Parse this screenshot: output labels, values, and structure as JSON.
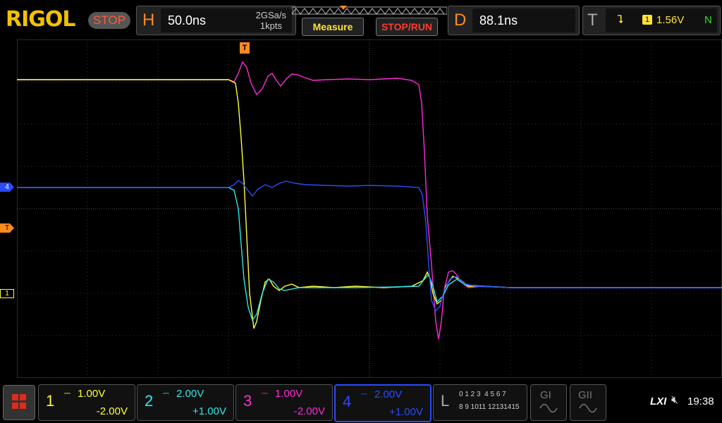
{
  "brand": "RIGOL",
  "run_state": "STOP",
  "horizontal": {
    "letter": "H",
    "timebase": "50.0ns",
    "sample_rate": "2GSa/s",
    "mem_depth": "1kpts"
  },
  "buttons": {
    "measure": "Measure",
    "stop_run": "STOP/RUN"
  },
  "delay": {
    "letter": "D",
    "value": "88.1ns"
  },
  "trigger": {
    "letter": "T",
    "source": "1",
    "level": "1.56V",
    "mode": "N"
  },
  "channels": [
    {
      "num": "1",
      "scale": "1.00V",
      "offset": "-2.00V",
      "color": "#ffff3a"
    },
    {
      "num": "2",
      "scale": "2.00V",
      "offset": "+1.00V",
      "color": "#2ee8e8"
    },
    {
      "num": "3",
      "scale": "1.00V",
      "offset": "-2.00V",
      "color": "#ff2bd6"
    },
    {
      "num": "4",
      "scale": "2.00V",
      "offset": "+1.00V",
      "color": "#2a4bff"
    }
  ],
  "logic": {
    "letter": "L",
    "row1": "0 1 2 3  4 5 6 7",
    "row2": "8 9 1011 12131415"
  },
  "gen1": "GI",
  "gen2": "GII",
  "markers": {
    "trigger_top": "T",
    "ch4_marker": "4",
    "trigger_level": "T",
    "ch1_marker": "1"
  },
  "status": {
    "lxi": "LXI",
    "time": "19:38"
  },
  "colors": {
    "accent": "#ff8a1f",
    "grid": "#3a3a3a"
  }
}
